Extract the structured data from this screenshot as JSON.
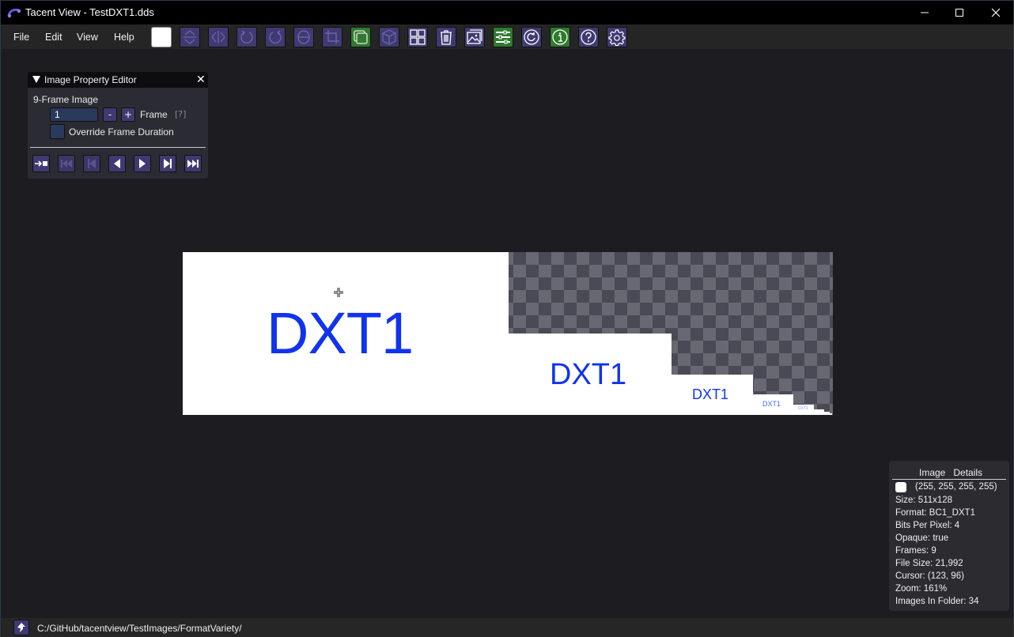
{
  "window": {
    "title": "Tacent View - TestDXT1.dds",
    "controls": [
      "minimize",
      "maximize",
      "close"
    ]
  },
  "menu": {
    "items": [
      "File",
      "Edit",
      "View",
      "Help"
    ]
  },
  "toolbar": {
    "buttons": [
      {
        "name": "background-color-swatch",
        "state": "enabled",
        "color": "#ffffff"
      },
      {
        "name": "flip-vertical-icon",
        "state": "disabled"
      },
      {
        "name": "flip-horizontal-icon",
        "state": "disabled"
      },
      {
        "name": "rotate-ccw-icon",
        "state": "disabled"
      },
      {
        "name": "rotate-cw-icon",
        "state": "disabled"
      },
      {
        "name": "rotate-theta-icon",
        "state": "disabled"
      },
      {
        "name": "crop-icon",
        "state": "disabled"
      },
      {
        "name": "multi-frame-icon",
        "state": "active"
      },
      {
        "name": "cubemap-icon",
        "state": "disabled"
      },
      {
        "name": "contact-sheet-icon",
        "state": "enabled"
      },
      {
        "name": "delete-icon",
        "state": "enabled"
      },
      {
        "name": "thumbnail-view-icon",
        "state": "enabled"
      },
      {
        "name": "property-editor-icon",
        "state": "active"
      },
      {
        "name": "refresh-icon",
        "state": "enabled"
      },
      {
        "name": "info-icon",
        "state": "active"
      },
      {
        "name": "help-icon",
        "state": "enabled"
      },
      {
        "name": "settings-icon",
        "state": "enabled"
      }
    ]
  },
  "property_editor": {
    "title": "Image Property Editor",
    "frame_count_label": "9-Frame Image",
    "frame_value": "1",
    "minus_label": "-",
    "plus_label": "+",
    "frame_label": "Frame",
    "help_label": "[?]",
    "override_label": "Override Frame Duration",
    "override_checked": false,
    "playback": [
      "loop-toggle",
      "first-frame-disabled",
      "prev-frame-disabled",
      "play-backward",
      "play-forward",
      "next-frame",
      "last-frame"
    ]
  },
  "image": {
    "mip_text": "DXT1",
    "text_color": "#1133ee"
  },
  "details": {
    "header_left": "Image",
    "header_right": "Details",
    "color_swatch": "#ffffff",
    "color_value": "(255, 255, 255, 255)",
    "size": "Size: 511x128",
    "format": "Format: BC1_DXT1",
    "bpp": "Bits Per Pixel: 4",
    "opaque": "Opaque: true",
    "frames": "Frames: 9",
    "file_size": "File Size: 21,992",
    "cursor": "Cursor: (123, 96)",
    "zoom": "Zoom: 161%",
    "images_in_folder": "Images In Folder: 34"
  },
  "status": {
    "path": "C:/GitHub/tacentview/TestImages/FormatVariety/"
  }
}
